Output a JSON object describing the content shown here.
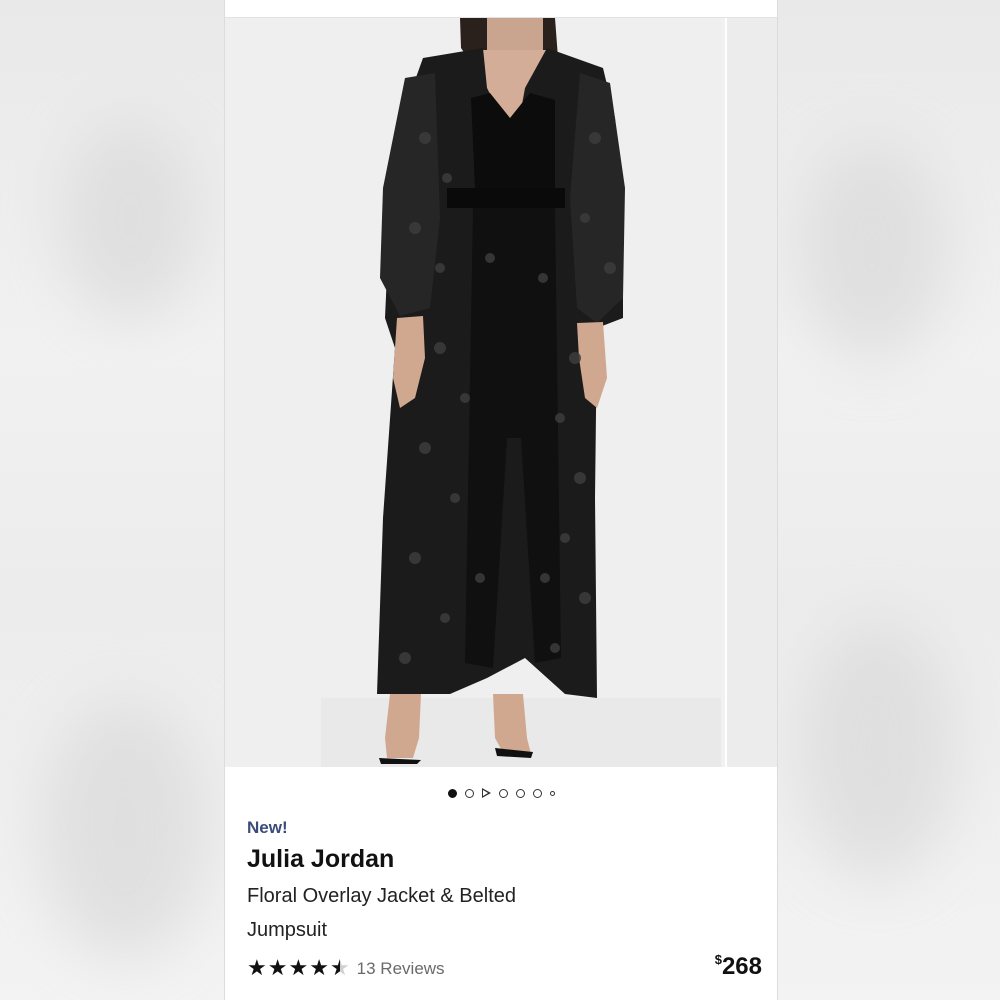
{
  "product": {
    "badge": "New!",
    "brand": "Julia Jordan",
    "name": "Floral Overlay Jacket & Belted Jumpsuit",
    "rating": 4.5,
    "rating_max": 5,
    "reviews_label": "13 Reviews",
    "price_currency": "$",
    "price_amount": "268"
  },
  "gallery": {
    "image_icon": "product-photo",
    "dots": [
      "active",
      "inactive",
      "video-play",
      "inactive",
      "inactive",
      "inactive",
      "small"
    ]
  },
  "colors": {
    "badge": "#3b4b7a",
    "garment": "#111111",
    "background": "#ffffff"
  }
}
